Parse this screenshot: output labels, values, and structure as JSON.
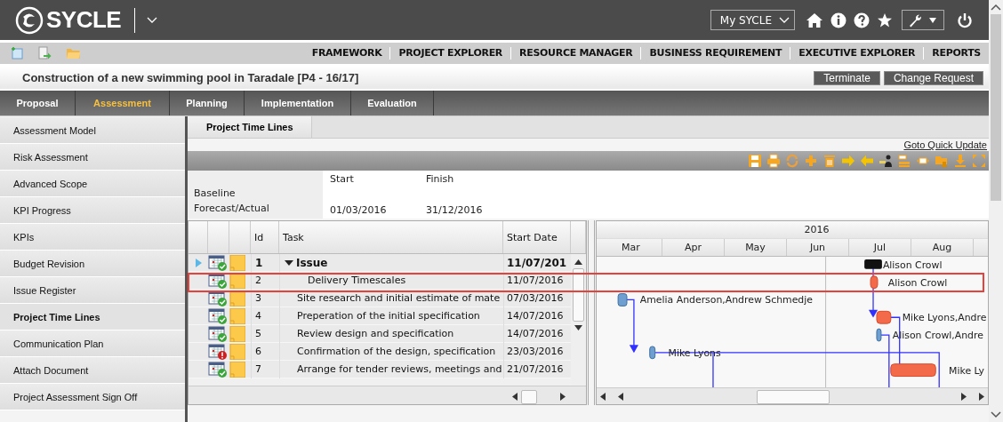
{
  "header": {
    "logo": "SYCLE",
    "my_menu": "My SYCLE"
  },
  "nav_links": [
    "FRAMEWORK",
    "PROJECT EXPLORER",
    "RESOURCE MANAGER",
    "BUSINESS REQUIREMENT",
    "EXECUTIVE EXPLORER",
    "REPORTS"
  ],
  "project_title": "Construction of a new swimming pool in Taradale [P4 - 16/17]",
  "actions": [
    "Terminate",
    "Change Request"
  ],
  "phase_tabs": [
    {
      "label": "Proposal",
      "selected": false
    },
    {
      "label": "Assessment",
      "selected": true
    },
    {
      "label": "Planning",
      "selected": false
    },
    {
      "label": "Implementation",
      "selected": false
    },
    {
      "label": "Evaluation",
      "selected": false
    }
  ],
  "sidebar": {
    "items": [
      {
        "label": "Assessment Model",
        "selected": false
      },
      {
        "label": "Risk Assessment",
        "selected": false
      },
      {
        "label": "Advanced Scope",
        "selected": false
      },
      {
        "label": "KPI Progress",
        "selected": false
      },
      {
        "label": "KPIs",
        "selected": false
      },
      {
        "label": "Budget Revision",
        "selected": false
      },
      {
        "label": "Issue Register",
        "selected": false
      },
      {
        "label": "Project Time Lines",
        "selected": true
      },
      {
        "label": "Communication Plan",
        "selected": false
      },
      {
        "label": "Attach Document",
        "selected": false
      },
      {
        "label": "Project Assessment Sign Off",
        "selected": false
      }
    ]
  },
  "content_tab": "Project Time Lines",
  "quick_update_link": "Goto Quick Update",
  "summary": {
    "start_label": "Start",
    "finish_label": "Finish",
    "baseline_label": "Baseline",
    "forecast_label": "Forecast/Actual",
    "forecast_start": "01/03/2016",
    "forecast_finish": "31/12/2016"
  },
  "grid": {
    "columns": [
      "Id",
      "Task",
      "Start Date"
    ],
    "rows": [
      {
        "id": "1",
        "task": "Issue",
        "start": "11/07/201",
        "kind": "summary",
        "expanded": true,
        "overdue": false,
        "current": true,
        "highlighted": false,
        "resource": "Alison Crowl"
      },
      {
        "id": "2",
        "task": "Delivery Timescales",
        "start": "11/07/2016",
        "kind": "child",
        "overdue": false,
        "current": false,
        "highlighted": true,
        "resource": "Alison Crowl"
      },
      {
        "id": "3",
        "task": "Site research and initial estimate of mate",
        "start": "07/03/2016",
        "kind": "task",
        "overdue": false,
        "current": false,
        "highlighted": false,
        "resource": "Amelia Anderson,Andrew Schmedje"
      },
      {
        "id": "4",
        "task": "Preperation of the initial specification",
        "start": "14/07/2016",
        "kind": "task",
        "overdue": false,
        "current": false,
        "highlighted": false,
        "resource": "Mike Lyons,Andre"
      },
      {
        "id": "5",
        "task": "Review design and specification",
        "start": "14/07/2016",
        "kind": "task",
        "overdue": false,
        "current": false,
        "highlighted": false,
        "resource": "Alison Crowl,Andre"
      },
      {
        "id": "6",
        "task": "Confirmation of the design, specification",
        "start": "23/03/2016",
        "kind": "task",
        "overdue": true,
        "current": false,
        "highlighted": false,
        "resource": "Mike Lyons"
      },
      {
        "id": "7",
        "task": "Arrange for tender reviews, meetings and",
        "start": "21/07/2016",
        "kind": "task",
        "overdue": false,
        "current": false,
        "highlighted": false,
        "resource": "Mike Ly"
      }
    ]
  },
  "gantt": {
    "year": "2016",
    "months": [
      "Mar",
      "Apr",
      "May",
      "Jun",
      "Jul",
      "Aug"
    ]
  }
}
